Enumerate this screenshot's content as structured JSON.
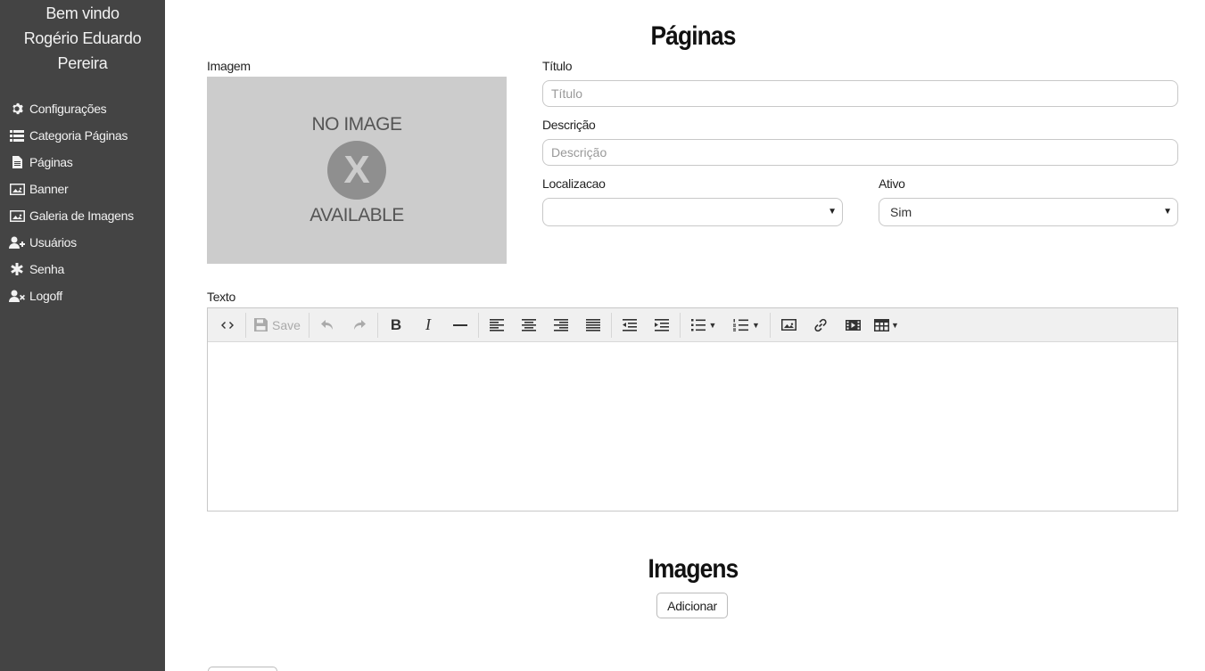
{
  "sidebar": {
    "welcome": "Bem vindo",
    "user": "Rogério Eduardo Pereira",
    "items": [
      {
        "label": "Configurações",
        "icon": "gear-icon"
      },
      {
        "label": "Categoria Páginas",
        "icon": "list-icon"
      },
      {
        "label": "Páginas",
        "icon": "file-icon"
      },
      {
        "label": "Banner",
        "icon": "picture-icon"
      },
      {
        "label": "Galeria de Imagens",
        "icon": "picture-icon"
      },
      {
        "label": "Usuários",
        "icon": "user-add-icon"
      },
      {
        "label": "Senha",
        "icon": "asterisk-icon"
      },
      {
        "label": "Logoff",
        "icon": "user-remove-icon"
      }
    ]
  },
  "main": {
    "title": "Páginas",
    "image_label": "Imagem",
    "no_image": {
      "line1": "NO IMAGE",
      "mark": "X",
      "line2": "AVAILABLE"
    },
    "titulo": {
      "label": "Título",
      "placeholder": "Título"
    },
    "descricao": {
      "label": "Descrição",
      "placeholder": "Descrição"
    },
    "localizacao": {
      "label": "Localizacao",
      "value": ""
    },
    "ativo": {
      "label": "Ativo",
      "value": "Sim"
    },
    "texto_label": "Texto",
    "toolbar": {
      "save": "Save"
    },
    "imagens_title": "Imagens",
    "add_button": "Adicionar"
  }
}
